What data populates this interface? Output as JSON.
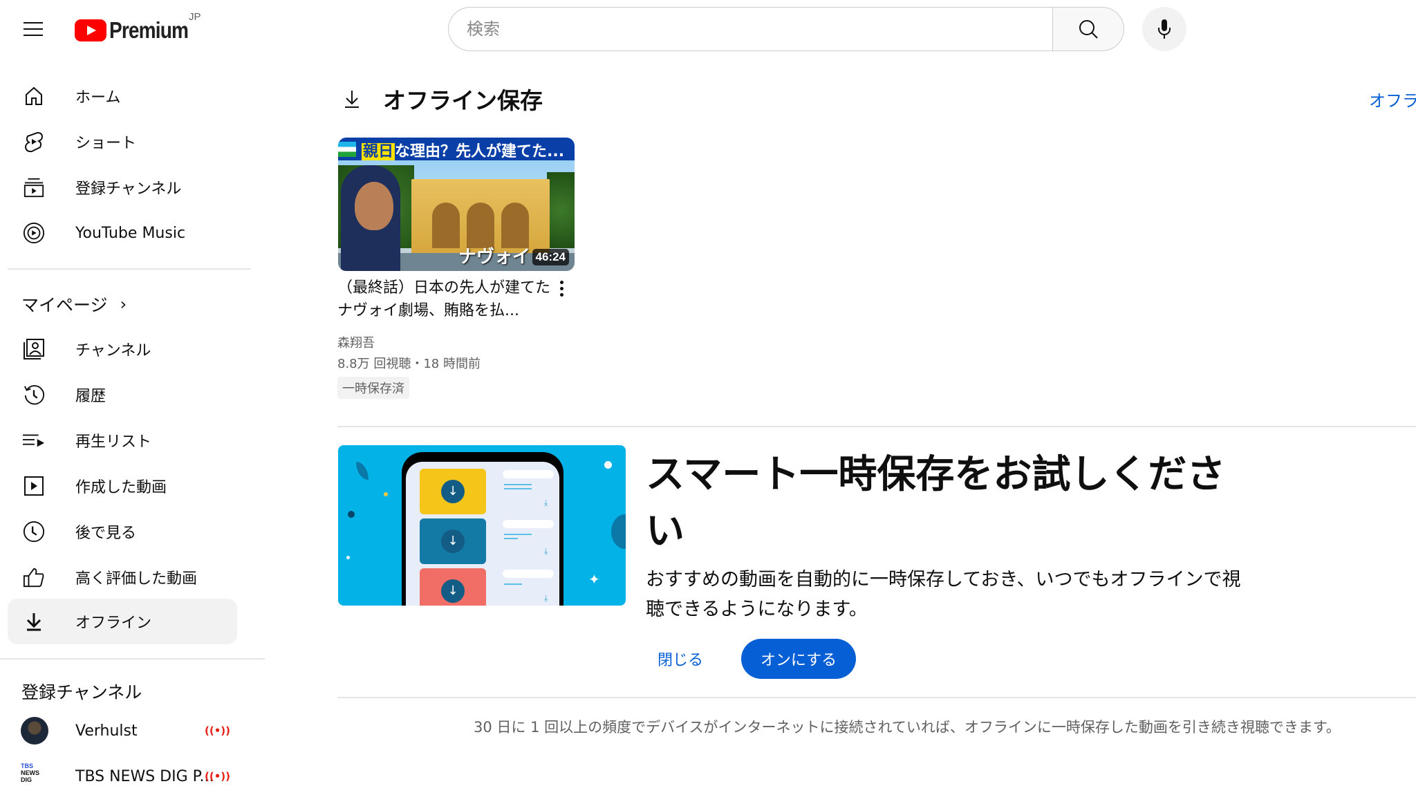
{
  "header": {
    "menu_icon": "hamburger-menu-icon",
    "logo_text": "Premium",
    "logo_region": "JP",
    "search_placeholder": "検索",
    "search_value": "",
    "search_icon": "search-icon",
    "mic_icon": "microphone-icon"
  },
  "sidebar": {
    "primary": [
      {
        "label": "ホーム",
        "icon": "home-icon"
      },
      {
        "label": "ショート",
        "icon": "shorts-icon"
      },
      {
        "label": "登録チャンネル",
        "icon": "subscriptions-icon"
      },
      {
        "label": "YouTube Music",
        "icon": "youtube-music-icon"
      }
    ],
    "my_page_title": "マイページ",
    "my_page": [
      {
        "label": "チャンネル",
        "icon": "your-channel-icon"
      },
      {
        "label": "履歴",
        "icon": "history-icon"
      },
      {
        "label": "再生リスト",
        "icon": "playlists-icon"
      },
      {
        "label": "作成した動画",
        "icon": "your-videos-icon"
      },
      {
        "label": "後で見る",
        "icon": "watch-later-icon"
      },
      {
        "label": "高く評価した動画",
        "icon": "liked-videos-icon"
      },
      {
        "label": "オフライン",
        "icon": "download-icon",
        "active": true
      }
    ],
    "subscriptions_title": "登録チャンネル",
    "subscriptions": [
      {
        "name": "Verhulst",
        "live": true,
        "live_icon": "((•))"
      },
      {
        "name": "TBS NEWS DIG P...",
        "live": true,
        "live_icon": "((•))",
        "avatar_text": "TBS NEWS DIG"
      }
    ]
  },
  "main": {
    "page_title": "オフライン保存",
    "right_link": "オフラ",
    "video": {
      "banner_highlight": "親日",
      "banner_text": "な理由？先人が建てた...",
      "overlay_text": "ナヴォイ",
      "duration": "46:24",
      "title": "（最終話）日本の先人が建てたナヴォイ劇場、賄賂を払...",
      "channel": "森翔吾",
      "meta": "8.8万 回視聴・18 時間前",
      "badge": "一時保存済"
    },
    "promo": {
      "title": "スマート一時保存をお試しください",
      "description": "おすすめの動画を自動的に一時保存しておき、いつでもオフラインで視聴できるようになります。",
      "close_label": "閉じる",
      "enable_label": "オンにする"
    },
    "footnote": "30 日に 1 回以上の頻度でデバイスがインターネットに接続されていれば、オフラインに一時保存した動画を引き続き視聴できます。"
  },
  "colors": {
    "accent_blue": "#065fd4",
    "brand_red": "#ff0000",
    "live_red": "#e62117",
    "promo_bg": "#03b2e6"
  }
}
